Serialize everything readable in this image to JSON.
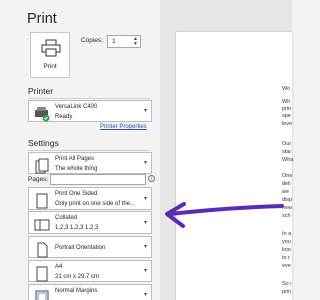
{
  "title": "Print",
  "print_button": {
    "label": "Print",
    "icon": "printer-icon"
  },
  "copies": {
    "label": "Copies:",
    "value": "1"
  },
  "printer": {
    "heading": "Printer",
    "name": "VersaLink C400",
    "status": "Ready",
    "properties_link": "Printer Properties"
  },
  "settings": {
    "heading": "Settings",
    "pages_label": "Pages:",
    "items": [
      {
        "line1": "Print All Pages",
        "line2": "The whole thing",
        "icon": "pages-icon"
      },
      {
        "line1": "Print One Sided",
        "line2": "Only print on one side of the...",
        "icon": "one-sided-icon"
      },
      {
        "line1": "Collated",
        "line2": "1,2,3    1,2,3    1,2,3",
        "icon": "collated-icon"
      },
      {
        "line1": "Portrait Orientation",
        "line2": "",
        "icon": "portrait-icon"
      },
      {
        "line1": "A4",
        "line2": "21 cm x 29.7 cm",
        "icon": "paper-size-icon"
      },
      {
        "line1": "Normal Margins",
        "line2": "",
        "icon": "margins-icon"
      }
    ]
  },
  "preview": {
    "lines": [
      "Wo",
      "Wh",
      "prin",
      "spe",
      "leve",
      "Our",
      "star",
      "Wha",
      "One",
      "deli",
      "we",
      "disp",
      "new",
      "sch",
      "In a",
      "you",
      "kno",
      "to r",
      "eve",
      "So i",
      "prin"
    ]
  },
  "annotation": {
    "arrow_color": "#5b2bb5"
  }
}
